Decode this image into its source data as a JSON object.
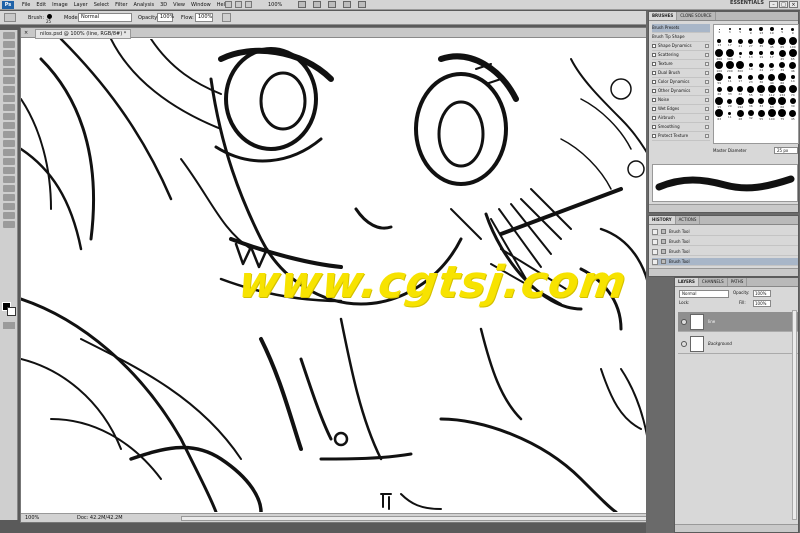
{
  "app": {
    "logo": "Ps"
  },
  "menu": [
    "File",
    "Edit",
    "Image",
    "Layer",
    "Select",
    "Filter",
    "Analysis",
    "3D",
    "View",
    "Window",
    "Help"
  ],
  "menubar_right": {
    "zoom": "100%",
    "workspace": "ESSENTIALS"
  },
  "options": {
    "brush_label": "Brush:",
    "brush_size": "25",
    "mode_label": "Mode:",
    "mode_value": "Normal",
    "opacity_label": "Opacity:",
    "opacity_value": "100%",
    "flow_label": "Flow:",
    "flow_value": "100%"
  },
  "document": {
    "tab_title": "nilos.psd @ 100% (line, RGB/8#) *",
    "close": "×",
    "status_zoom": "100%",
    "status_doc": "Doc: 42.2M/42.2M"
  },
  "watermark": "www.cgtsj.com",
  "brushes_panel": {
    "tabs": [
      "BRUSHES",
      "CLONE SOURCE"
    ],
    "list": [
      {
        "label": "Brush Presets",
        "sel": true
      },
      {
        "label": "Brush Tip Shape"
      },
      {
        "label": "Shape Dynamics"
      },
      {
        "label": "Scattering"
      },
      {
        "label": "Texture"
      },
      {
        "label": "Dual Brush"
      },
      {
        "label": "Color Dynamics"
      },
      {
        "label": "Other Dynamics"
      },
      {
        "label": "Noise"
      },
      {
        "label": "Wet Edges"
      },
      {
        "label": "Airbrush"
      },
      {
        "label": "Smoothing"
      },
      {
        "label": "Protect Texture"
      }
    ],
    "grid_numbers": [
      "1",
      "3",
      "5",
      "9",
      "13",
      "19",
      "5",
      "9",
      "13",
      "17",
      "21",
      "27",
      "35",
      "45",
      "65",
      "100",
      "200",
      "300",
      "9",
      "13",
      "19",
      "17",
      "45",
      "65",
      "100",
      "200",
      "300",
      "14",
      "24",
      "27",
      "39",
      "46",
      "59",
      "11",
      "17",
      "23",
      "36",
      "44",
      "60",
      "14",
      "26",
      "33",
      "42",
      "55",
      "70",
      "112",
      "134",
      "74",
      "95",
      "29",
      "192",
      "36",
      "33",
      "63",
      "66",
      "39",
      "63",
      "11",
      "48",
      "32",
      "55",
      "100",
      "75",
      "45"
    ],
    "master_label": "Master Diameter",
    "master_value": "25 px"
  },
  "history_panel": {
    "tabs": [
      "HISTORY",
      "ACTIONS"
    ],
    "items": [
      {
        "label": "Brush Tool"
      },
      {
        "label": "Brush Tool"
      },
      {
        "label": "Brush Tool"
      },
      {
        "label": "Brush Tool",
        "sel": true
      }
    ]
  },
  "layers_panel": {
    "tabs": [
      "LAYERS",
      "CHANNELS",
      "PATHS"
    ],
    "mode": "Normal",
    "opacity_label": "Opacity:",
    "opacity_value": "100%",
    "lock_label": "Lock:",
    "fill_label": "Fill:",
    "fill_value": "100%",
    "layers": [
      {
        "name": "line",
        "sel": true
      },
      {
        "name": "Background"
      }
    ]
  }
}
